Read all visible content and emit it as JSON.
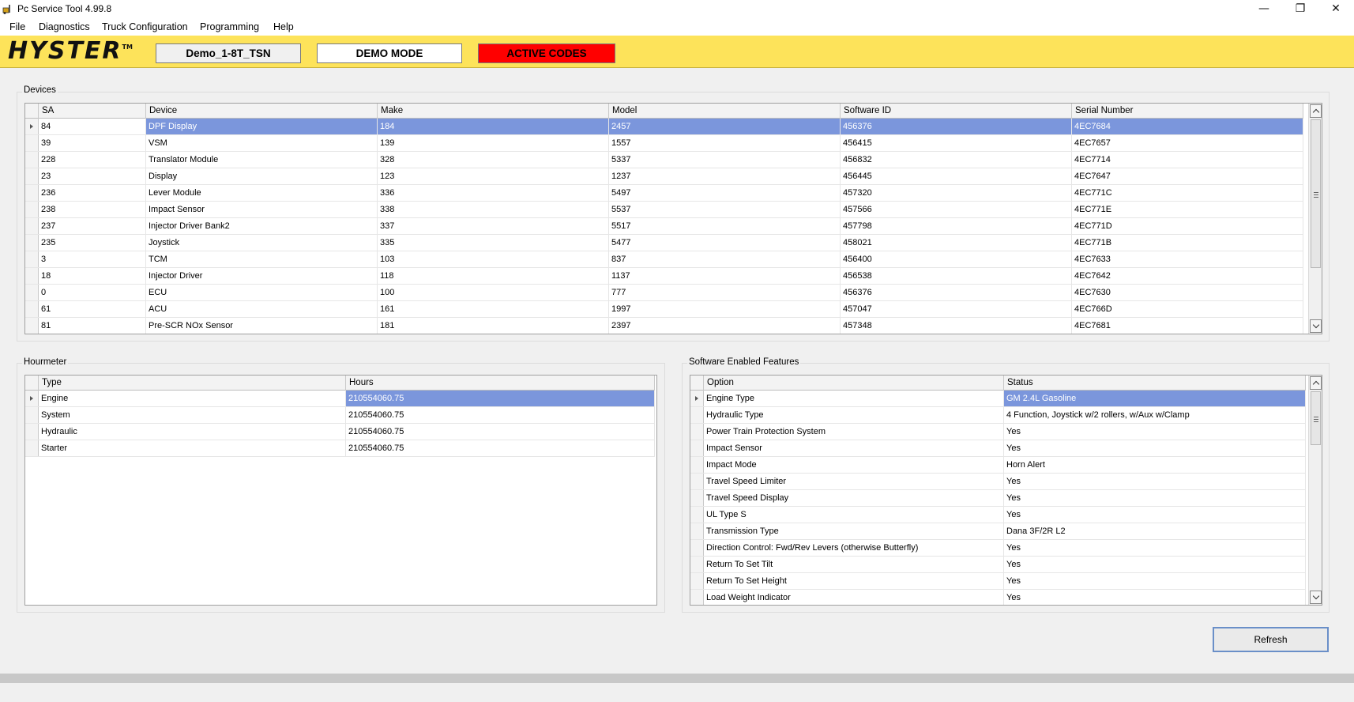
{
  "window": {
    "title": "Pc Service Tool 4.99.8",
    "controls": {
      "minimize": "—",
      "restore": "❐",
      "close": "✕"
    }
  },
  "menu": [
    "File",
    "Diagnostics",
    "Truck Configuration",
    "Programming",
    "Help"
  ],
  "brand": {
    "logo": "HYSTER",
    "logo_tm": "TM",
    "truck_name": "Demo_1-8T_TSN",
    "mode": "DEMO MODE",
    "active_codes": "ACTIVE CODES",
    "colors": {
      "bar": "#fde35a",
      "active_codes": "#ff0000"
    }
  },
  "devices": {
    "label": "Devices",
    "columns": [
      "SA",
      "Device",
      "Make",
      "Model",
      "Software ID",
      "Serial Number"
    ],
    "rows": [
      [
        "84",
        "DPF Display",
        "184",
        "2457",
        "456376",
        "4EC7684"
      ],
      [
        "39",
        "VSM",
        "139",
        "1557",
        "456415",
        "4EC7657"
      ],
      [
        "228",
        "Translator Module",
        "328",
        "5337",
        "456832",
        "4EC7714"
      ],
      [
        "23",
        "Display",
        "123",
        "1237",
        "456445",
        "4EC7647"
      ],
      [
        "236",
        "Lever Module",
        "336",
        "5497",
        "457320",
        "4EC771C"
      ],
      [
        "238",
        "Impact Sensor",
        "338",
        "5537",
        "457566",
        "4EC771E"
      ],
      [
        "237",
        "Injector Driver Bank2",
        "337",
        "5517",
        "457798",
        "4EC771D"
      ],
      [
        "235",
        "Joystick",
        "335",
        "5477",
        "458021",
        "4EC771B"
      ],
      [
        "3",
        "TCM",
        "103",
        "837",
        "456400",
        "4EC7633"
      ],
      [
        "18",
        "Injector Driver",
        "118",
        "1137",
        "456538",
        "4EC7642"
      ],
      [
        "0",
        "ECU",
        "100",
        "777",
        "456376",
        "4EC7630"
      ],
      [
        "61",
        "ACU",
        "161",
        "1997",
        "457047",
        "4EC766D"
      ],
      [
        "81",
        "Pre-SCR NOx Sensor",
        "181",
        "2397",
        "457348",
        "4EC7681"
      ]
    ]
  },
  "hourmeter": {
    "label": "Hourmeter",
    "columns": [
      "Type",
      "Hours"
    ],
    "rows": [
      [
        "Engine",
        "210554060.75"
      ],
      [
        "System",
        "210554060.75"
      ],
      [
        "Hydraulic",
        "210554060.75"
      ],
      [
        "Starter",
        "210554060.75"
      ]
    ]
  },
  "features": {
    "label": "Software Enabled Features",
    "columns": [
      "Option",
      "Status"
    ],
    "rows": [
      [
        "Engine Type",
        "GM 2.4L Gasoline"
      ],
      [
        "Hydraulic Type",
        "4 Function, Joystick w/2 rollers, w/Aux w/Clamp"
      ],
      [
        "Power Train Protection System",
        "Yes"
      ],
      [
        "Impact Sensor",
        "Yes"
      ],
      [
        "Impact Mode",
        "Horn Alert"
      ],
      [
        "Travel Speed Limiter",
        "Yes"
      ],
      [
        "Travel Speed Display",
        "Yes"
      ],
      [
        "UL Type S",
        "Yes"
      ],
      [
        "Transmission Type",
        "Dana 3F/2R L2"
      ],
      [
        "Direction Control: Fwd/Rev Levers (otherwise Butterfly)",
        "Yes"
      ],
      [
        "Return To Set Tilt",
        "Yes"
      ],
      [
        "Return To Set Height",
        "Yes"
      ],
      [
        "Load Weight Indicator",
        "Yes"
      ]
    ]
  },
  "buttons": {
    "refresh": "Refresh"
  },
  "selection_color": "#7b96dc"
}
